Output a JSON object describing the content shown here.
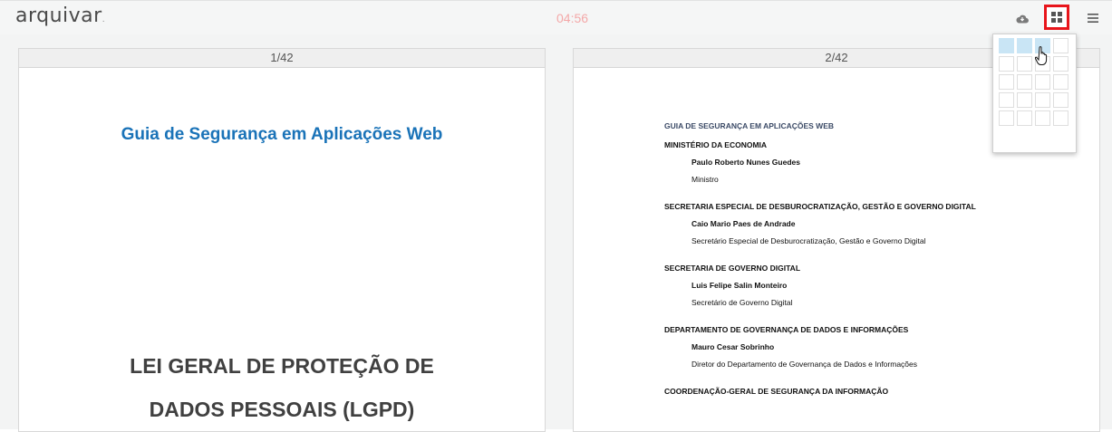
{
  "header": {
    "logo": "arquivar",
    "logo_mark": ".",
    "timer": "04:56",
    "icons": [
      "cloud-download-icon",
      "grid-layout-icon",
      "menu-icon"
    ]
  },
  "pages": [
    {
      "label": "1/42",
      "title": "Guia de Segurança em Aplicações Web",
      "law_line1": "LEI GERAL DE PROTEÇÃO DE",
      "law_line2": "DADOS PESSOAIS (LGPD)"
    },
    {
      "label": "2/42",
      "guide": "GUIA DE SEGURANÇA EM APLICAÇÕES WEB",
      "sections": [
        {
          "title": "MINISTÉRIO DA ECONOMIA",
          "person": "Paulo Roberto Nunes Guedes",
          "role": "Ministro"
        },
        {
          "title": "SECRETARIA ESPECIAL DE DESBUROCRATIZAÇÃO, GESTÃO E GOVERNO DIGITAL",
          "person": "Caio Mario Paes de Andrade",
          "role": "Secretário Especial de Desburocratização, Gestão e Governo Digital"
        },
        {
          "title": "SECRETARIA DE GOVERNO DIGITAL",
          "person": "Luis Felipe Salin Monteiro",
          "role": "Secretário de Governo Digital"
        },
        {
          "title": "DEPARTAMENTO DE GOVERNANÇA DE DADOS E INFORMAÇÕES",
          "person": "Mauro Cesar Sobrinho",
          "role": "Diretor do Departamento de Governança de Dados e Informações"
        },
        {
          "title": "COORDENAÇÃO-GERAL DE SEGURANÇA DA INFORMAÇÃO",
          "person": "",
          "role": ""
        }
      ]
    }
  ],
  "layout_picker": {
    "columns": 4,
    "rows": 5,
    "selected_columns": 3,
    "selected_rows": 1
  }
}
